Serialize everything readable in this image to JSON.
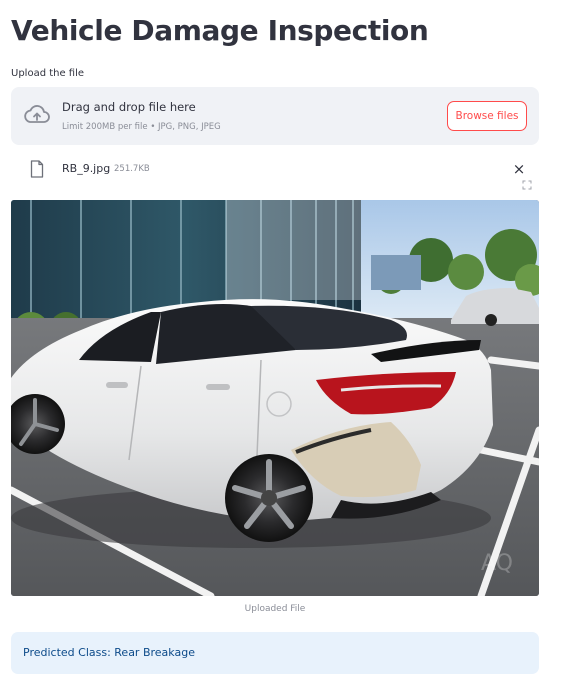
{
  "page": {
    "title": "Vehicle Damage Inspection"
  },
  "uploader": {
    "label": "Upload the file",
    "icon": "cloud-upload-icon",
    "drop_text": "Drag and drop file here",
    "limit_text": "Limit 200MB per file • JPG, PNG, JPEG",
    "browse_label": "Browse files",
    "accent_color": "#ff4b4b"
  },
  "file": {
    "icon": "file-icon",
    "name": "RB_9.jpg",
    "size": "251.7KB",
    "remove_label": "×"
  },
  "image": {
    "caption": "Uploaded File",
    "fullscreen_icon": "fullscreen-icon",
    "watermark": "AQ"
  },
  "result": {
    "text": "Predicted Class: Rear Breakage",
    "background": "#e8f2fc",
    "color": "#0d4b8a"
  }
}
